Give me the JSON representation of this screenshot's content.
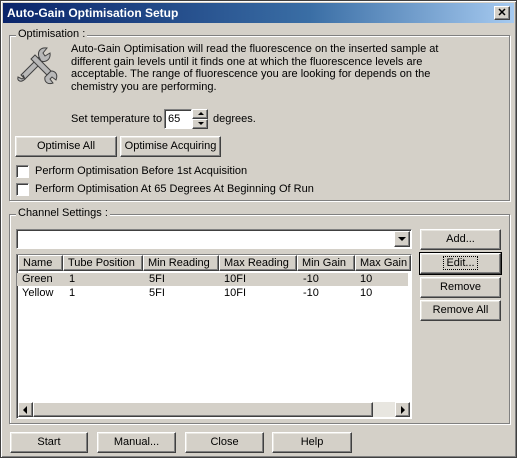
{
  "window": {
    "title": "Auto-Gain Optimisation Setup",
    "close_glyph": "✕"
  },
  "optimisation": {
    "group_title": "Optimisation :",
    "icon": "wrench-icon",
    "description": "Auto-Gain Optimisation will read the fluorescence on the inserted sample at different gain levels until it finds one at which the fluorescence levels are acceptable. The range of fluorescence you are looking for depends on the chemistry you are performing.",
    "temperature_prefix": "Set temperature to",
    "temperature_value": "65",
    "temperature_suffix": "degrees.",
    "optimise_all_label": "Optimise All",
    "optimise_acquiring_label": "Optimise Acquiring",
    "checkbox_before_first_label": "Perform Optimisation Before 1st Acquisition",
    "checkbox_before_first_checked": false,
    "checkbox_at_temp_label": "Perform Optimisation At 65 Degrees At Beginning Of Run",
    "checkbox_at_temp_checked": false
  },
  "channel_settings": {
    "group_title": "Channel Settings :",
    "dropdown_value": "",
    "columns": [
      "Name",
      "Tube Position",
      "Min Reading",
      "Max Reading",
      "Min Gain",
      "Max Gain"
    ],
    "rows": [
      [
        "Green",
        "1",
        "5FI",
        "10FI",
        "-10",
        "10"
      ],
      [
        "Yellow",
        "1",
        "5FI",
        "10FI",
        "-10",
        "10"
      ]
    ],
    "selected_row": 0,
    "add_label": "Add...",
    "edit_label": "Edit...",
    "remove_label": "Remove",
    "remove_all_label": "Remove All"
  },
  "footer": {
    "start_label": "Start",
    "manual_label": "Manual...",
    "close_label": "Close",
    "help_label": "Help"
  }
}
